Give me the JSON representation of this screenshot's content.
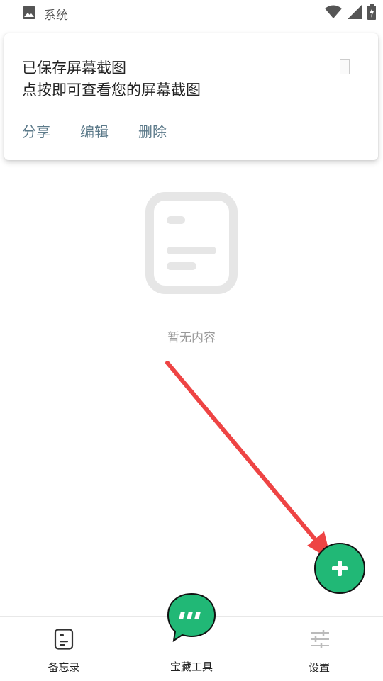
{
  "status_bar": {
    "app_label": "系统"
  },
  "notification": {
    "title": "已保存屏幕截图",
    "text": "点按即可查看您的屏幕截图",
    "actions": [
      "分享",
      "编辑",
      "删除"
    ]
  },
  "empty_state": {
    "text": "暂无内容"
  },
  "fab": {
    "icon": "plus-icon",
    "color": "#21b876"
  },
  "bottom_nav": {
    "items": [
      {
        "label": "备忘录",
        "icon": "memo-icon"
      },
      {
        "label": "宝藏工具",
        "icon": "chat-bubble-icon"
      },
      {
        "label": "设置",
        "icon": "sliders-icon"
      }
    ]
  },
  "colors": {
    "accent": "#21b876",
    "annotation_arrow": "#ee4444"
  }
}
